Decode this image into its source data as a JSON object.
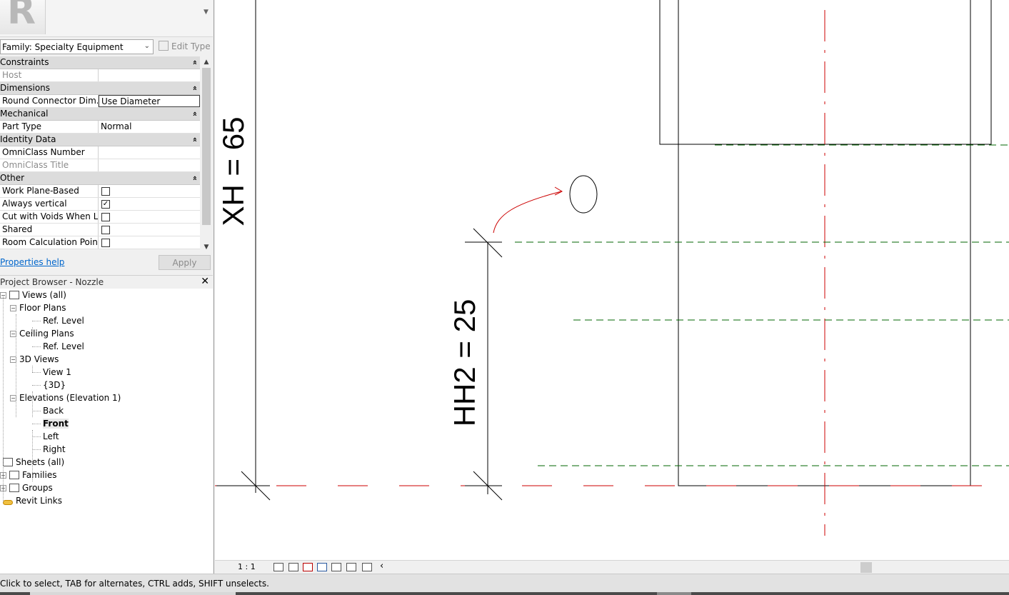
{
  "properties": {
    "family_select": "Family: Specialty Equipment",
    "edit_type": "Edit Type",
    "groups": [
      {
        "name": "Constraints",
        "rows": [
          {
            "name": "Host",
            "value": "",
            "disabled": true
          }
        ]
      },
      {
        "name": "Dimensions",
        "rows": [
          {
            "name": "Round Connector Dim...",
            "value": "Use Diameter",
            "editing": true
          }
        ]
      },
      {
        "name": "Mechanical",
        "rows": [
          {
            "name": "Part Type",
            "value": "Normal"
          }
        ]
      },
      {
        "name": "Identity Data",
        "rows": [
          {
            "name": "OmniClass Number",
            "value": ""
          },
          {
            "name": "OmniClass Title",
            "value": "",
            "disabled": true
          }
        ]
      },
      {
        "name": "Other",
        "rows": [
          {
            "name": "Work Plane-Based",
            "checkbox": true,
            "checked": false
          },
          {
            "name": "Always vertical",
            "checkbox": true,
            "checked": true
          },
          {
            "name": "Cut with Voids When L...",
            "checkbox": true,
            "checked": false
          },
          {
            "name": "Shared",
            "checkbox": true,
            "checked": false
          },
          {
            "name": "Room Calculation Point",
            "checkbox": true,
            "checked": false
          }
        ]
      }
    ],
    "help_link": "Properties help",
    "apply_label": "Apply"
  },
  "project_browser": {
    "title": "Project Browser - Nozzle",
    "close": "✕",
    "tree": [
      {
        "label": "Views (all)",
        "level": 0,
        "expander": "−",
        "icon": "views-icon"
      },
      {
        "label": "Floor Plans",
        "level": 1,
        "expander": "−"
      },
      {
        "label": "Ref. Level",
        "level": 2
      },
      {
        "label": "Ceiling Plans",
        "level": 1,
        "expander": "−"
      },
      {
        "label": "Ref. Level",
        "level": 2
      },
      {
        "label": "3D Views",
        "level": 1,
        "expander": "−"
      },
      {
        "label": "View 1",
        "level": 2
      },
      {
        "label": "{3D}",
        "level": 2
      },
      {
        "label": "Elevations (Elevation 1)",
        "level": 1,
        "expander": "−"
      },
      {
        "label": "Back",
        "level": 2
      },
      {
        "label": "Front",
        "level": 2,
        "selected": true
      },
      {
        "label": "Left",
        "level": 2
      },
      {
        "label": "Right",
        "level": 2
      },
      {
        "label": "Sheets (all)",
        "level": 0,
        "icon": "sheets-icon"
      },
      {
        "label": "Families",
        "level": 0,
        "expander": "+",
        "icon": "families-icon"
      },
      {
        "label": "Groups",
        "level": 0,
        "expander": "+",
        "icon": "groups-icon"
      },
      {
        "label": "Revit Links",
        "level": 0,
        "icon": "revit-links-icon"
      }
    ]
  },
  "canvas": {
    "dim_xh": "XH = 65",
    "dim_hh2": "HH2 = 25",
    "colors": {
      "ref_plane_red": "#cc0000",
      "ref_plane_green": "#006600",
      "line": "#000000"
    }
  },
  "view_control_bar": {
    "scale": "1 : 1",
    "collapse_arrow": "‹"
  },
  "status_bar": {
    "text": "Click to select, TAB for alternates, CTRL adds, SHIFT unselects."
  }
}
